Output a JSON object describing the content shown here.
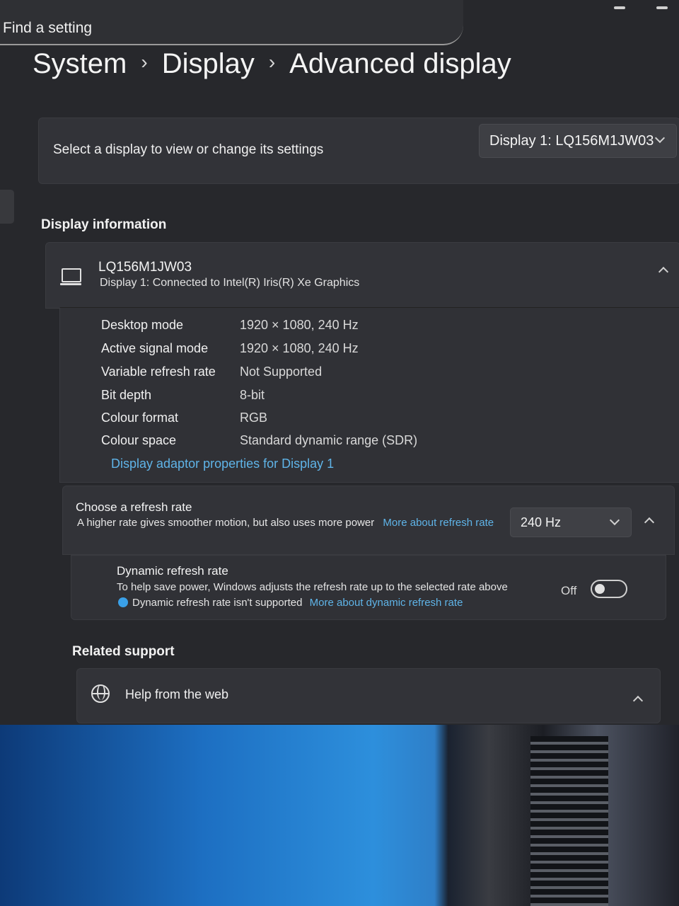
{
  "search": {
    "placeholder": "Find a setting"
  },
  "breadcrumb": {
    "items": [
      "System",
      "Display",
      "Advanced display"
    ]
  },
  "select_display": {
    "label": "Select a display to view or change its settings",
    "dropdown_value": "Display 1: LQ156M1JW03"
  },
  "display_information": {
    "section_title": "Display information",
    "monitor_name": "LQ156M1JW03",
    "monitor_subtitle": "Display 1: Connected to Intel(R) Iris(R) Xe Graphics",
    "rows": [
      {
        "key": "Desktop mode",
        "value": "1920 × 1080, 240 Hz"
      },
      {
        "key": "Active signal mode",
        "value": "1920 × 1080, 240 Hz"
      },
      {
        "key": "Variable refresh rate",
        "value": "Not Supported"
      },
      {
        "key": "Bit depth",
        "value": "8-bit"
      },
      {
        "key": "Colour format",
        "value": "RGB"
      },
      {
        "key": "Colour space",
        "value": "Standard dynamic range (SDR)"
      }
    ],
    "adaptor_link": "Display adaptor properties for Display 1"
  },
  "refresh_rate": {
    "title": "Choose a refresh rate",
    "description": "A higher rate gives smoother motion, but also uses more power",
    "link": "More about refresh rate",
    "dropdown_value": "240 Hz"
  },
  "dynamic_refresh": {
    "title": "Dynamic refresh rate",
    "description": "To help save power, Windows adjusts the refresh rate up to the selected rate above",
    "note": "Dynamic refresh rate isn't supported",
    "link": "More about dynamic refresh rate",
    "toggle_label": "Off",
    "toggle_on": false
  },
  "related_support": {
    "section_title": "Related support",
    "help_item": "Help from the web"
  }
}
